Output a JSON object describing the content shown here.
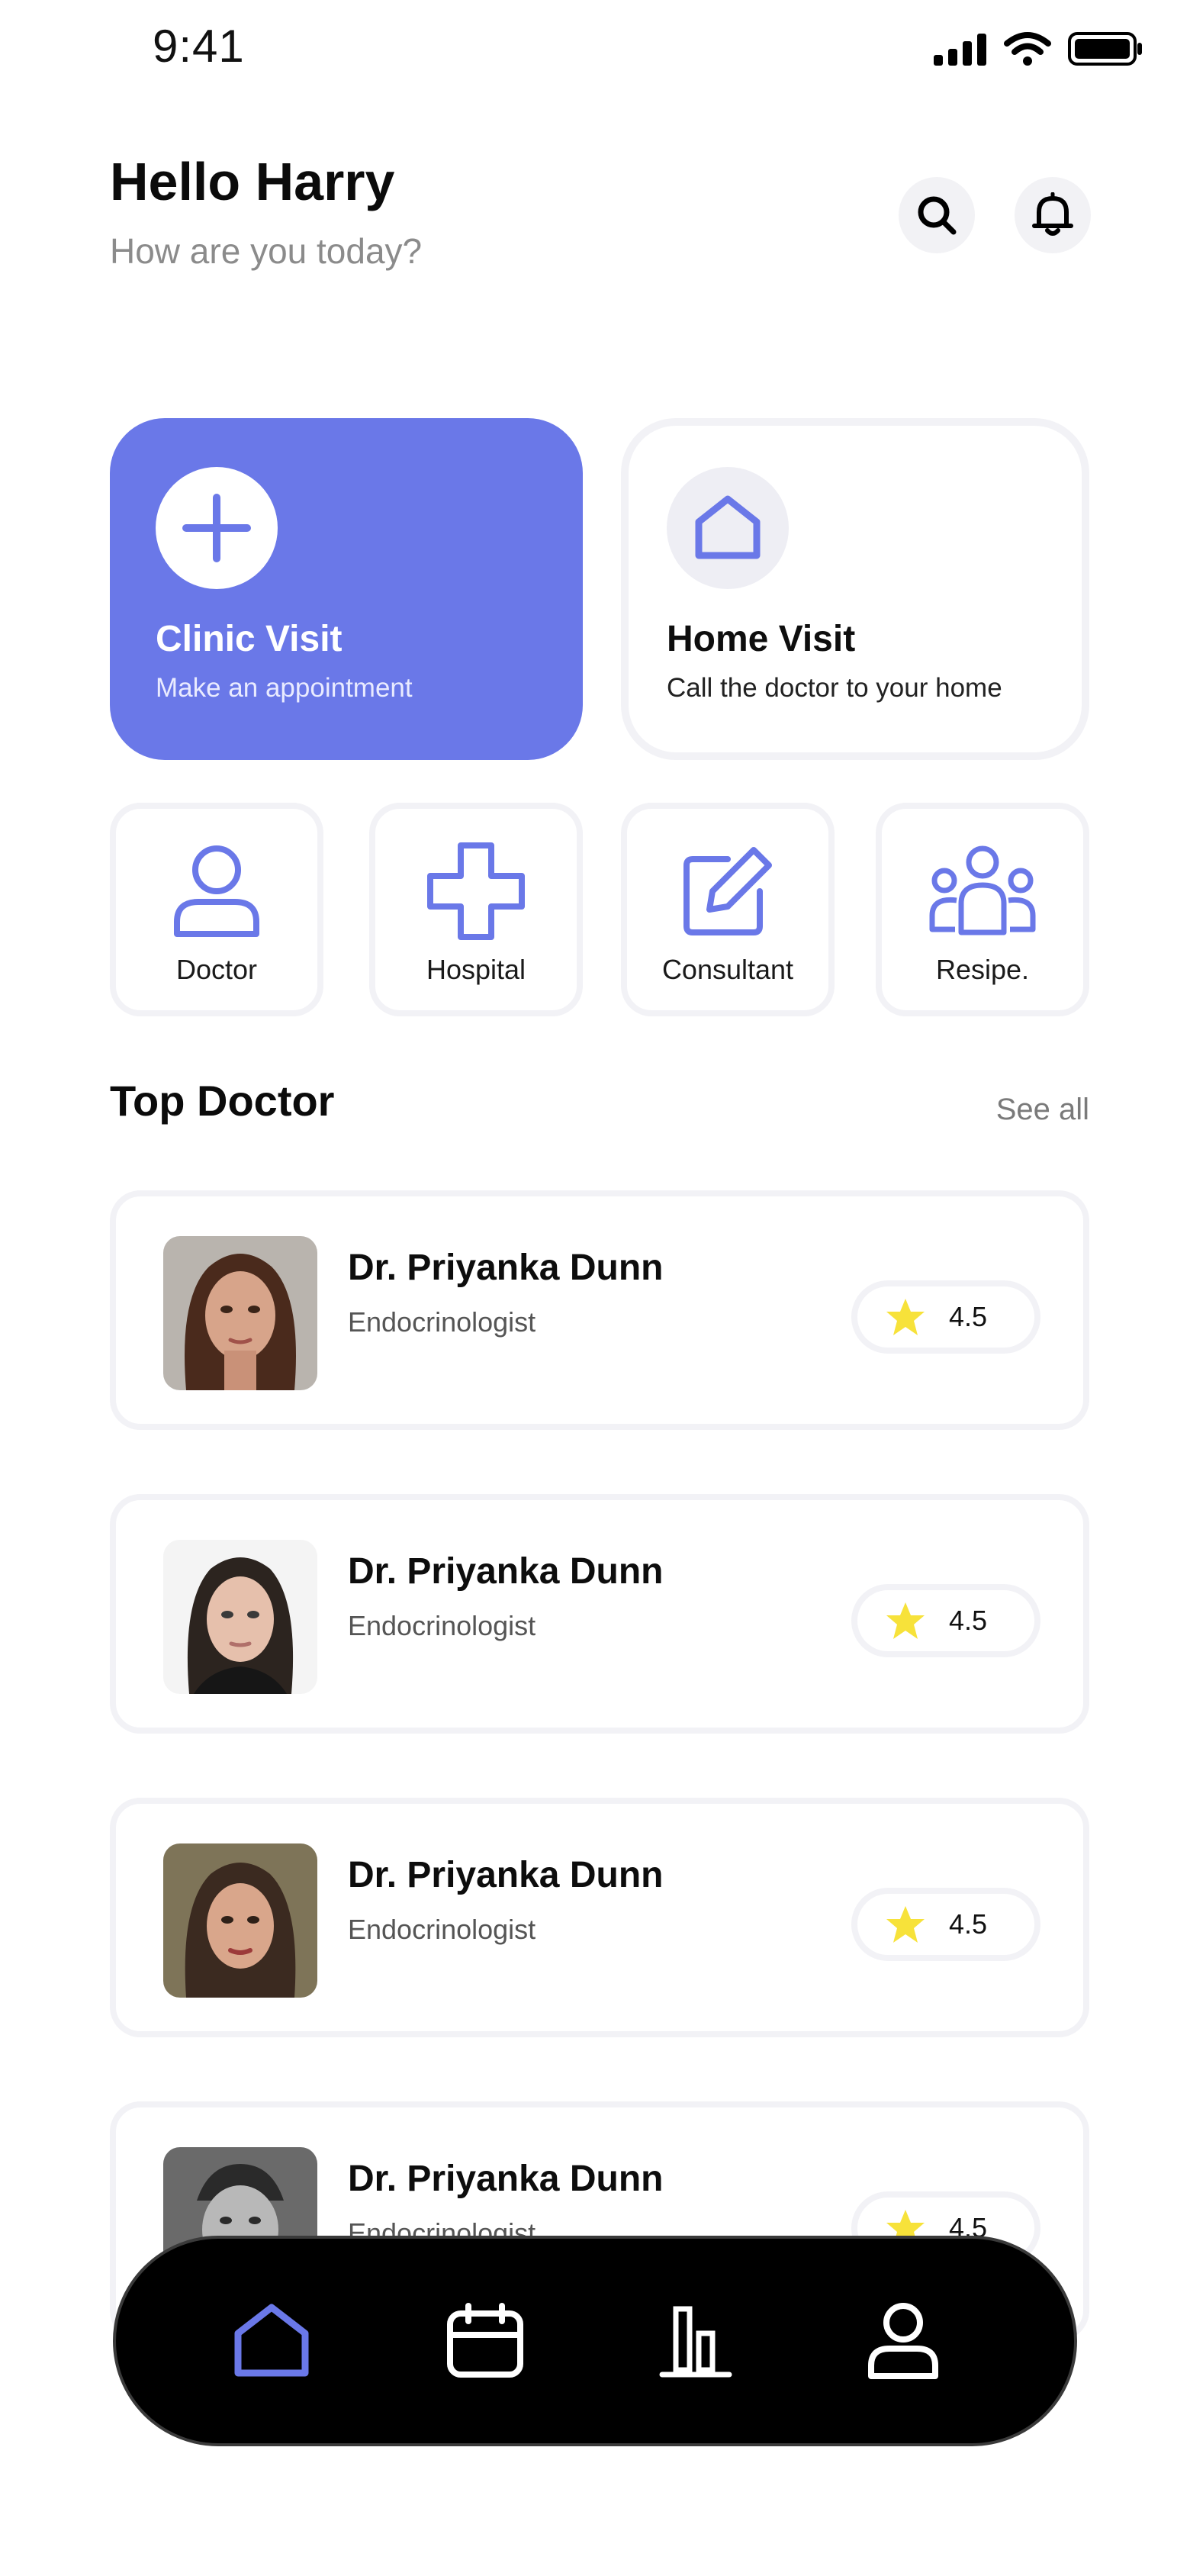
{
  "status": {
    "time": "9:41"
  },
  "header": {
    "title": "Hello Harry",
    "subtitle": "How are you today?"
  },
  "visits": [
    {
      "title": "Clinic Visit",
      "subtitle": "Make an appointment",
      "icon": "plus-icon",
      "color": "#6a78e8"
    },
    {
      "title": "Home Visit",
      "subtitle": "Call the doctor to your home",
      "icon": "house-icon"
    }
  ],
  "categories": [
    {
      "label": "Doctor",
      "icon": "user-icon"
    },
    {
      "label": "Hospital",
      "icon": "medical-cross-icon"
    },
    {
      "label": "Consultant",
      "icon": "edit-icon"
    },
    {
      "label": "Resipe.",
      "icon": "group-icon"
    }
  ],
  "top_doctor": {
    "title": "Top Doctor",
    "see_all": "See all",
    "doctors": [
      {
        "name": "Dr. Priyanka Dunn",
        "specialty": "Endocrinologist",
        "rating": "4.5"
      },
      {
        "name": "Dr. Priyanka Dunn",
        "specialty": "Endocrinologist",
        "rating": "4.5"
      },
      {
        "name": "Dr. Priyanka Dunn",
        "specialty": "Endocrinologist",
        "rating": "4.5"
      },
      {
        "name": "Dr. Priyanka Dunn",
        "specialty": "Endocrinologist",
        "rating": "4.5"
      }
    ]
  },
  "nav": [
    {
      "icon": "home-icon",
      "active": true
    },
    {
      "icon": "calendar-icon",
      "active": false
    },
    {
      "icon": "chart-icon",
      "active": false
    },
    {
      "icon": "profile-icon",
      "active": false
    }
  ],
  "colors": {
    "accent": "#6a78e8",
    "star": "#f7e23a",
    "nav_bg": "#000000"
  }
}
